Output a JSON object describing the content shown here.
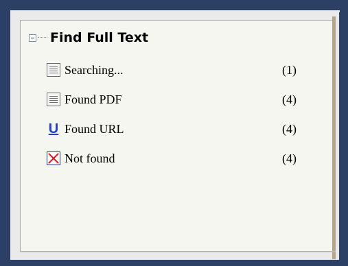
{
  "tree": {
    "root": {
      "label": "Find Full Text",
      "expanded": true
    },
    "items": [
      {
        "label": "Searching...",
        "count": "(1)",
        "icon": "document-icon"
      },
      {
        "label": "Found PDF",
        "count": "(4)",
        "icon": "document-icon"
      },
      {
        "label": "Found URL",
        "count": "(4)",
        "icon": "url-icon"
      },
      {
        "label": "Not found",
        "count": "(4)",
        "icon": "not-found-icon"
      }
    ],
    "url_icon_glyph": "U"
  },
  "colors": {
    "frame": "#2b4064",
    "panel": "#f6f6f0",
    "url_icon": "#1f3cd6",
    "not_found_x": "#e01414"
  }
}
